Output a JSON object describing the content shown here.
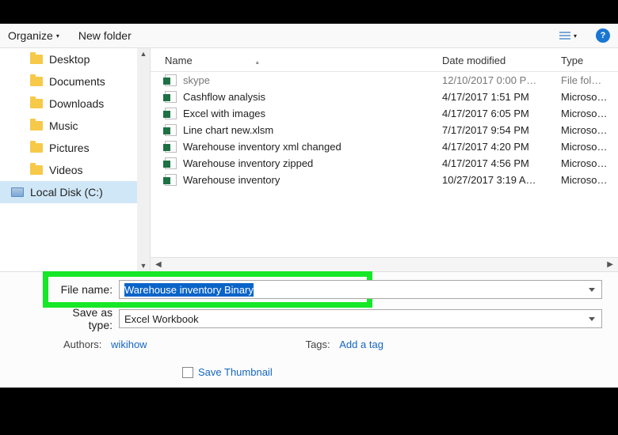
{
  "toolbar": {
    "organize": "Organize",
    "newfolder": "New folder"
  },
  "sidebar": {
    "items": [
      {
        "label": "Desktop"
      },
      {
        "label": "Documents"
      },
      {
        "label": "Downloads"
      },
      {
        "label": "Music"
      },
      {
        "label": "Pictures"
      },
      {
        "label": "Videos"
      },
      {
        "label": "Local Disk (C:)"
      }
    ]
  },
  "columns": {
    "name": "Name",
    "date": "Date modified",
    "type": "Type"
  },
  "files": [
    {
      "name": "skype",
      "date": "12/10/2017 0:00 P…",
      "type": "File fol…",
      "cut": true
    },
    {
      "name": "Cashflow analysis",
      "date": "4/17/2017 1:51 PM",
      "type": "Microso…"
    },
    {
      "name": "Excel with images",
      "date": "4/17/2017 6:05 PM",
      "type": "Microso…"
    },
    {
      "name": "Line chart new.xlsm",
      "date": "7/17/2017 9:54 PM",
      "type": "Microso…"
    },
    {
      "name": "Warehouse inventory xml changed",
      "date": "4/17/2017 4:20 PM",
      "type": "Microso…"
    },
    {
      "name": "Warehouse inventory zipped",
      "date": "4/17/2017 4:56 PM",
      "type": "Microso…"
    },
    {
      "name": "Warehouse inventory",
      "date": "10/27/2017 3:19 A…",
      "type": "Microso…"
    }
  ],
  "filename": {
    "label": "File name:",
    "value": "Warehouse inventory Binary"
  },
  "savetype": {
    "label": "Save as type:",
    "value": "Excel Workbook"
  },
  "meta": {
    "authors_label": "Authors:",
    "authors_value": "wikihow",
    "tags_label": "Tags:",
    "tags_value": "Add a tag"
  },
  "thumb": {
    "label": "Save Thumbnail"
  }
}
